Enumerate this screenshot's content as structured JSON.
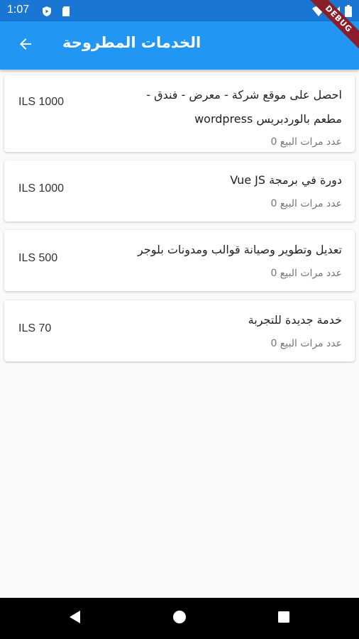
{
  "status_bar": {
    "time": "1:07",
    "debug_label": "DEBUG",
    "icons": [
      "play-protect-icon",
      "sd-card-icon",
      "wifi-icon",
      "signal-icon",
      "battery-icon"
    ]
  },
  "app_bar": {
    "title": "الخدمات المطروحة",
    "back_icon": "arrow-back-icon"
  },
  "services": [
    {
      "title_line1": "احصل على موقع شركة - معرض - فندق -",
      "title_line2": "مطعم بالوردبريس wordpress",
      "sales": "عدد مرات البيع 0",
      "price": "ILS 1000"
    },
    {
      "title_line1": "دورة في برمجة Vue JS",
      "sales": "عدد مرات البيع 0",
      "price": "ILS 1000"
    },
    {
      "title_line1": "تعديل وتطوير وصيانة قوالب ومدونات بلوجر",
      "sales": "عدد مرات البيع 0",
      "price": "ILS 500"
    },
    {
      "title_line1": "خدمة جديدة للتجربة",
      "sales": "عدد مرات البيع 0",
      "price": "ILS 70"
    }
  ],
  "colors": {
    "status_bar": "#1976d2",
    "app_bar": "#2196f3",
    "background": "#fafafa",
    "debug_ribbon": "#8b1e2b"
  }
}
